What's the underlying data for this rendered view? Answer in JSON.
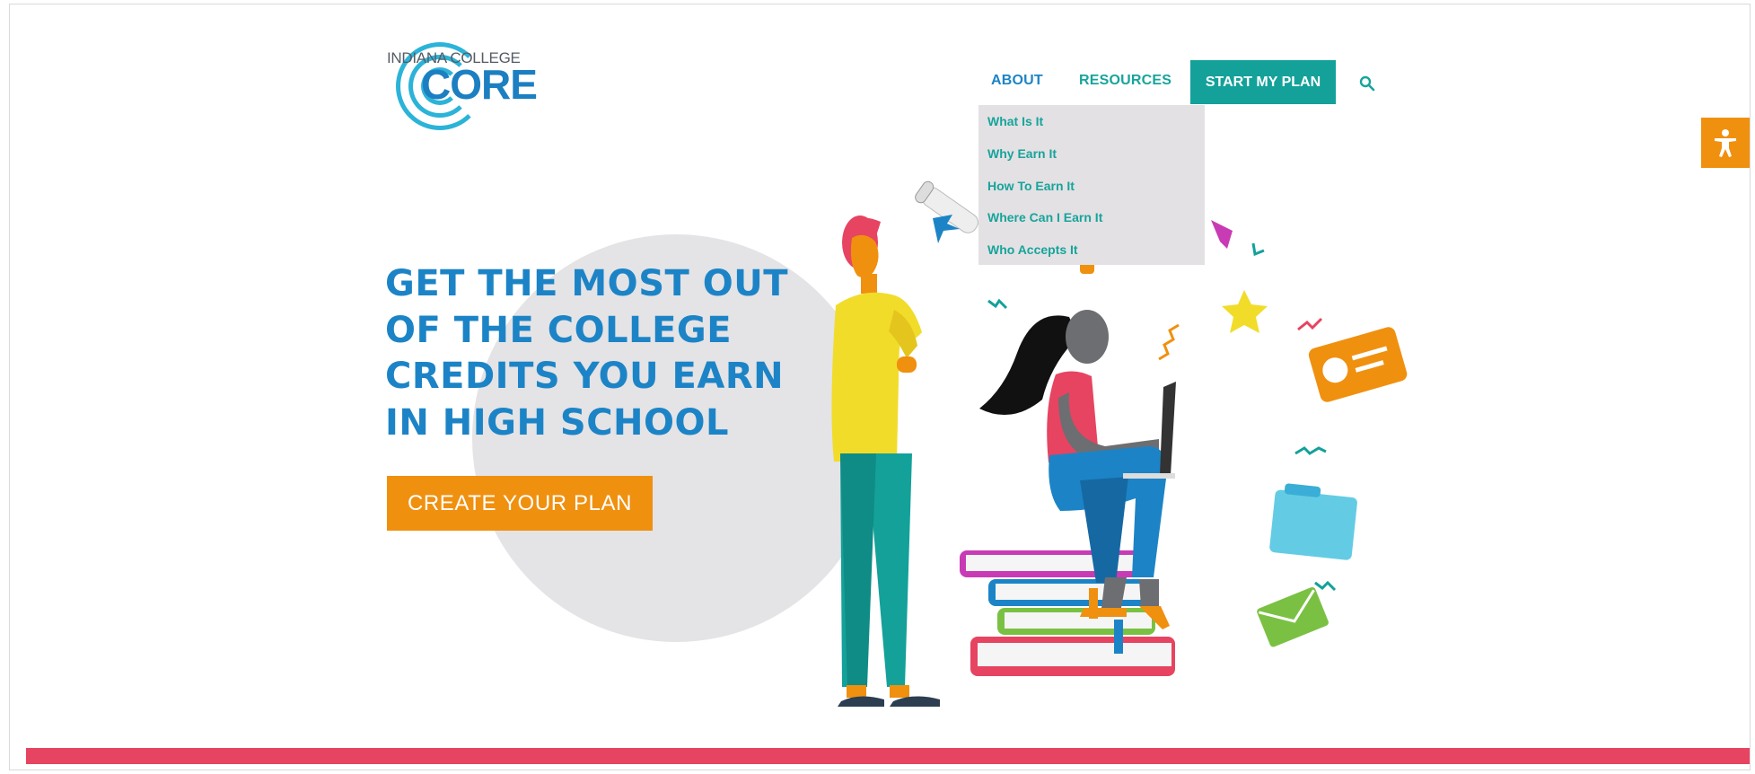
{
  "logo": {
    "line1": "INDIANA COLLEGE",
    "line2": "CORE"
  },
  "nav": {
    "about": "ABOUT",
    "resources": "RESOURCES",
    "start_plan": "START MY PLAN",
    "search_icon": "search-icon"
  },
  "about_menu": {
    "items": [
      "What Is It",
      "Why Earn It",
      "How To Earn It",
      "Where Can I Earn It",
      "Who Accepts It"
    ]
  },
  "hero": {
    "headline_lines": [
      "GET THE MOST OUT",
      "OF THE COLLEGE",
      "CREDITS YOU EARN",
      "IN HIGH SCHOOL"
    ],
    "cta_label": "CREATE YOUR PLAN"
  },
  "accessibility": {
    "icon": "accessibility-icon"
  },
  "colors": {
    "brand_blue": "#1c84c6",
    "teal": "#13a19a",
    "orange": "#f0900f",
    "accent_red": "#e64461",
    "dropdown_bg": "#e3e1e4"
  }
}
